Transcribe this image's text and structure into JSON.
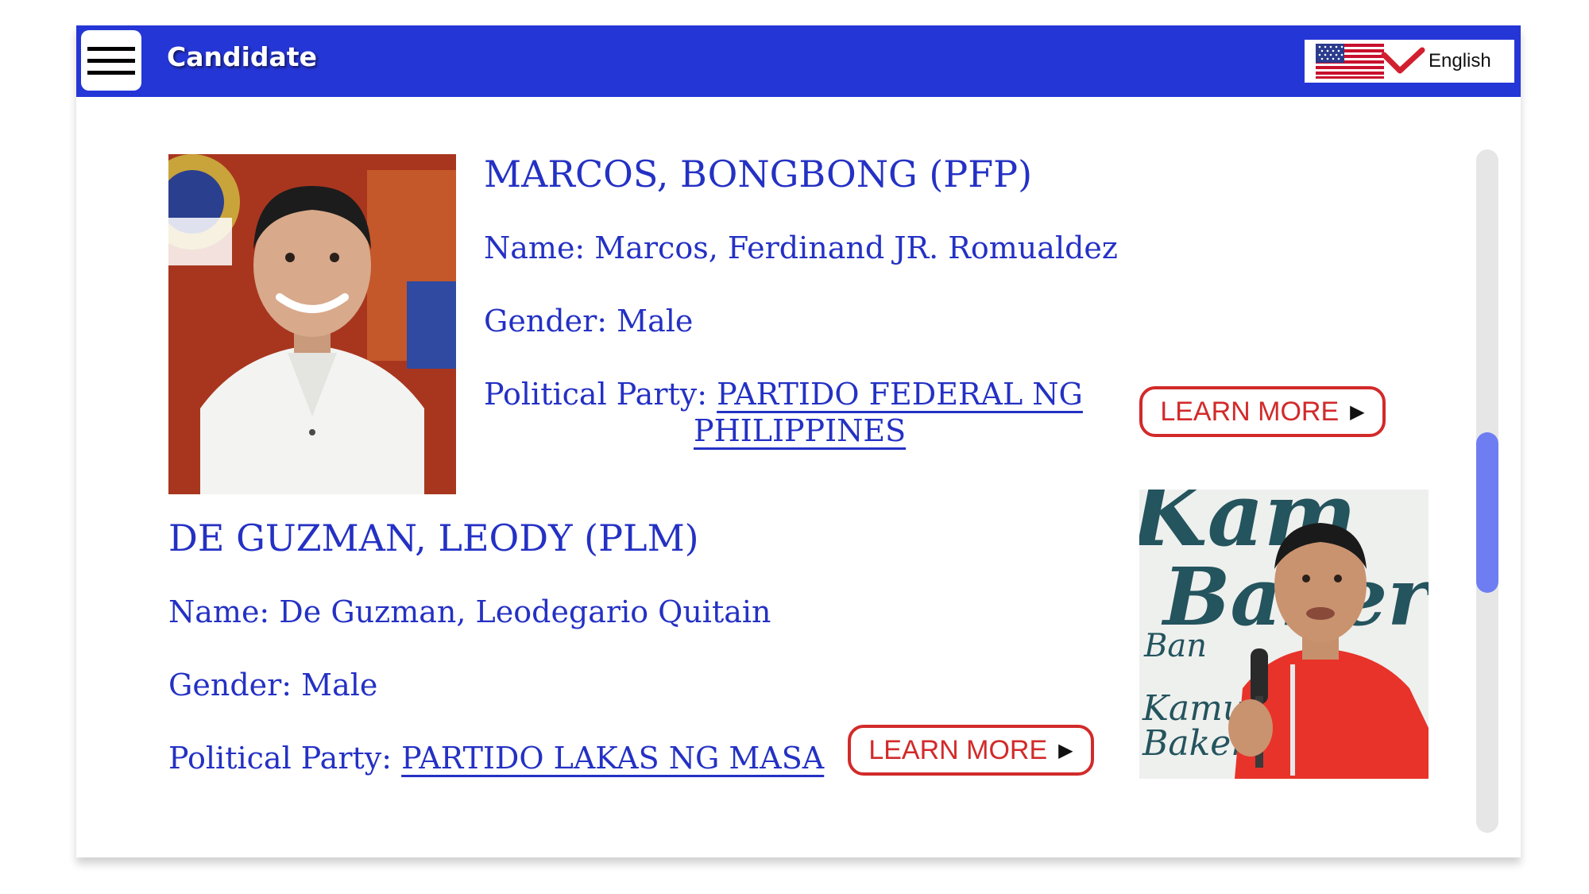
{
  "header": {
    "title": "Candidate",
    "language": "English",
    "colors": {
      "bar": "#2536d6",
      "accent": "#d22a2a",
      "text": "#2431c4"
    }
  },
  "candidates": [
    {
      "heading": "MARCOS, BONGBONG (PFP)",
      "name": "Name: Marcos, Ferdinand JR. Romualdez",
      "gender": "Gender: Male",
      "party_label": "Political Party: ",
      "party_line1": "PARTIDO FEDERAL NG",
      "party_line2": "PHILIPPINES",
      "button": "LEARN MORE"
    },
    {
      "heading": "DE GUZMAN, LEODY (PLM)",
      "name": "Name: De Guzman, Leodegario Quitain",
      "gender": "Gender: Male",
      "party_label": "Political Party: ",
      "party": "PARTIDO LAKAS NG MASA",
      "button": "LEARN MORE",
      "photo_sign_line1": "Kamu",
      "photo_sign_line2": "Baker",
      "photo_sign_small": "Ban"
    }
  ]
}
